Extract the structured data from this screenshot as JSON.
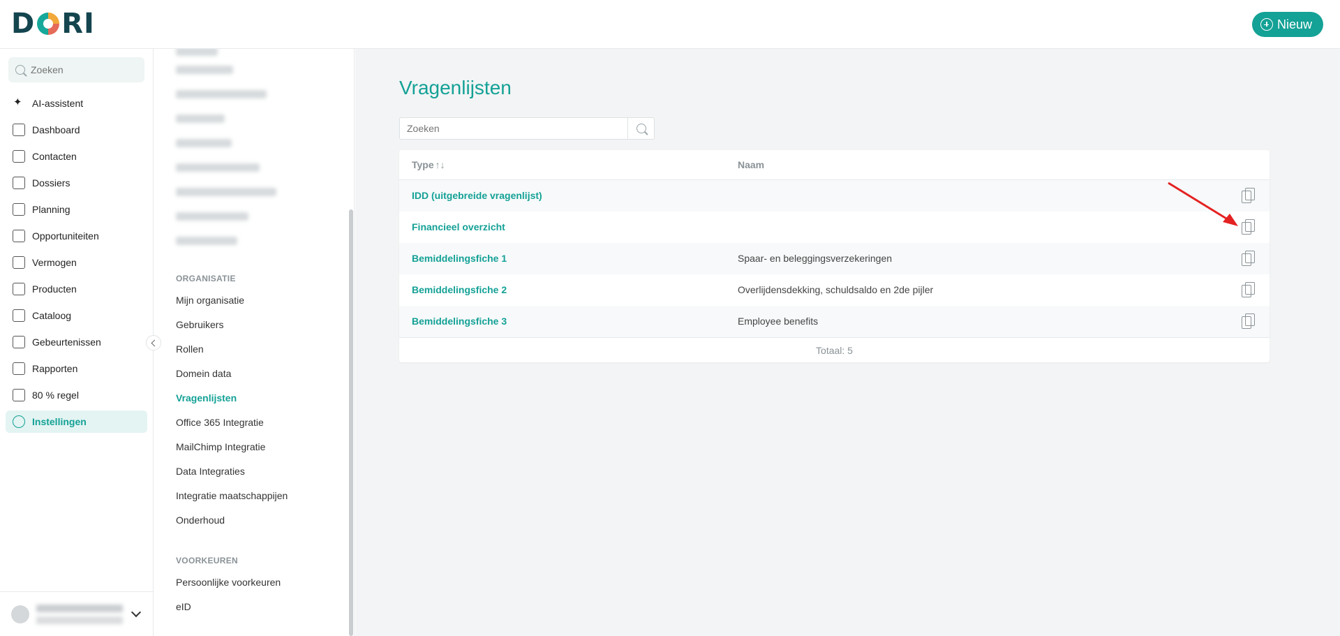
{
  "app": {
    "logo_text": "DORI",
    "brand_color": "#14a196"
  },
  "header": {
    "new_button_label": "Nieuw"
  },
  "sidebar": {
    "search_placeholder": "Zoeken",
    "items": [
      {
        "label": "AI-assistent",
        "icon": "sparkle-icon",
        "active": false
      },
      {
        "label": "Dashboard",
        "icon": "dashboard-icon",
        "active": false
      },
      {
        "label": "Contacten",
        "icon": "handshake-icon",
        "active": false
      },
      {
        "label": "Dossiers",
        "icon": "folder-icon",
        "active": false
      },
      {
        "label": "Planning",
        "icon": "calendar-icon",
        "active": false
      },
      {
        "label": "Opportuniteiten",
        "icon": "lightbulb-icon",
        "active": false
      },
      {
        "label": "Vermogen",
        "icon": "wallet-icon",
        "active": false
      },
      {
        "label": "Producten",
        "icon": "product-icon",
        "active": false
      },
      {
        "label": "Cataloog",
        "icon": "catalog-icon",
        "active": false
      },
      {
        "label": "Gebeurtenissen",
        "icon": "events-icon",
        "active": false
      },
      {
        "label": "Rapporten",
        "icon": "report-icon",
        "active": false
      },
      {
        "label": "80 % regel",
        "icon": "rule-icon",
        "active": false
      },
      {
        "label": "Instellingen",
        "icon": "gear-icon",
        "active": true
      }
    ]
  },
  "subnav": {
    "organisatie_heading": "ORGANISATIE",
    "organisatie_items": [
      "Mijn organisatie",
      "Gebruikers",
      "Rollen",
      "Domein data",
      "Vragenlijsten",
      "Office 365 Integratie",
      "MailChimp Integratie",
      "Data Integraties",
      "Integratie maatschappijen",
      "Onderhoud"
    ],
    "active_item": "Vragenlijsten",
    "voorkeuren_heading": "VOORKEUREN",
    "voorkeuren_items": [
      "Persoonlijke voorkeuren",
      "eID"
    ]
  },
  "main": {
    "title": "Vragenlijsten",
    "search_placeholder": "Zoeken",
    "table": {
      "col_type": "Type",
      "sort_glyph": "↑↓",
      "col_name": "Naam",
      "rows": [
        {
          "type": "IDD (uitgebreide vragenlijst)",
          "name": ""
        },
        {
          "type": "Financieel overzicht",
          "name": ""
        },
        {
          "type": "Bemiddelingsfiche 1",
          "name": "Spaar- en beleggingsverzekeringen"
        },
        {
          "type": "Bemiddelingsfiche 2",
          "name": "Overlijdensdekking, schuldsaldo en 2de pijler"
        },
        {
          "type": "Bemiddelingsfiche 3",
          "name": "Employee benefits"
        }
      ],
      "total_label": "Totaal: 5"
    }
  },
  "annotation": {
    "arrow_color": "#e52222"
  }
}
